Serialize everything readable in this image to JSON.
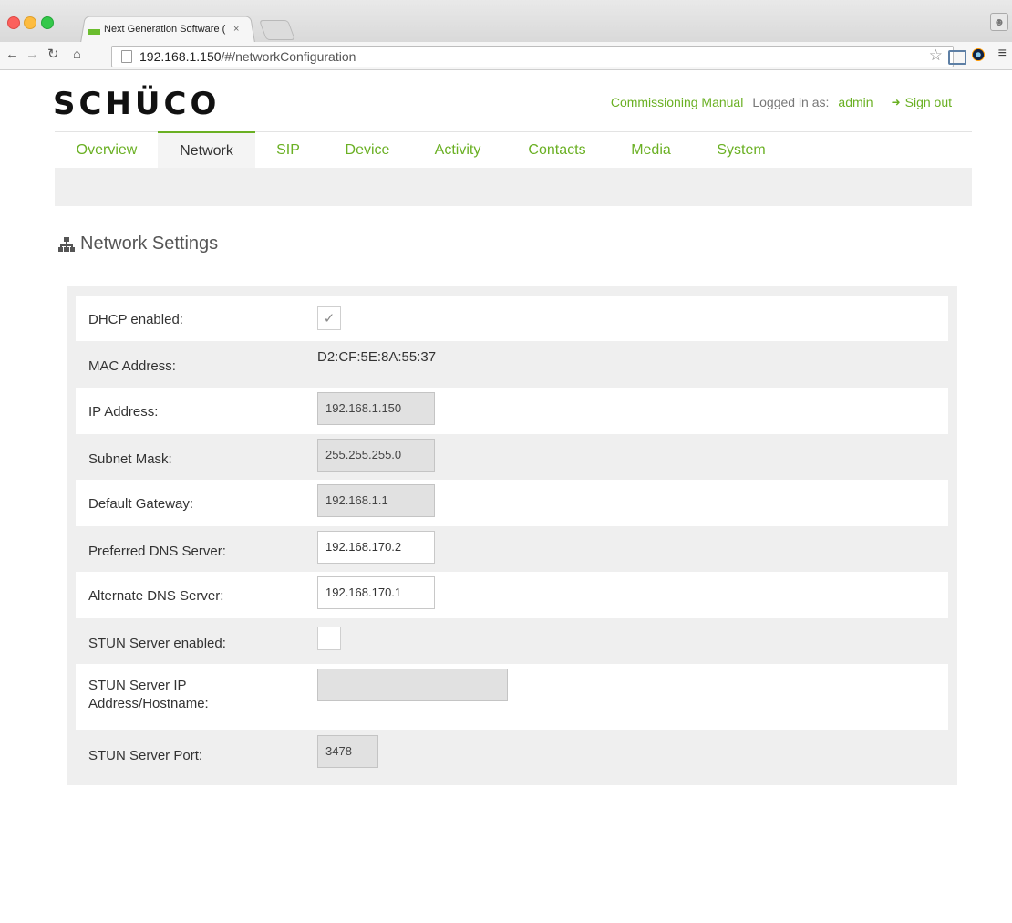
{
  "browser": {
    "tab_title": "Next Generation Software (",
    "tab_close": "×",
    "url_host": "192.168.1.150",
    "url_path": "/#/networkConfiguration"
  },
  "header": {
    "logo": "SCHÜCO",
    "manual_link": "Commissioning Manual",
    "logged_in_label": "Logged in as:",
    "username": "admin",
    "sign_out": "Sign out"
  },
  "nav": {
    "tabs": [
      {
        "label": "Overview"
      },
      {
        "label": "Network"
      },
      {
        "label": "SIP"
      },
      {
        "label": "Device"
      },
      {
        "label": "Activity"
      },
      {
        "label": "Contacts"
      },
      {
        "label": "Media"
      },
      {
        "label": "System"
      }
    ],
    "active": "Network"
  },
  "section": {
    "title": "Network Settings"
  },
  "settings": {
    "dhcp": {
      "label": "DHCP enabled:",
      "checked": true,
      "check_glyph": "✓"
    },
    "mac": {
      "label": "MAC Address:",
      "value": "D2:CF:5E:8A:55:37"
    },
    "ip": {
      "label": "IP Address:",
      "value": "192.168.1.150"
    },
    "subnet": {
      "label": "Subnet Mask:",
      "value": "255.255.255.0"
    },
    "gateway": {
      "label": "Default Gateway:",
      "value": "192.168.1.1"
    },
    "dns1": {
      "label": "Preferred DNS Server:",
      "value": "192.168.170.2"
    },
    "dns2": {
      "label": "Alternate DNS Server:",
      "value": "192.168.170.1"
    },
    "stun_enabled": {
      "label": "STUN Server enabled:",
      "checked": false
    },
    "stun_host": {
      "label_line1": "STUN Server IP",
      "label_line2": "Address/Hostname:",
      "value": ""
    },
    "stun_port": {
      "label": "STUN Server Port:",
      "value": "3478"
    }
  },
  "colors": {
    "accent": "#6ab023",
    "panel_bg": "#efefef",
    "disabled_field": "#e1e1e1"
  }
}
